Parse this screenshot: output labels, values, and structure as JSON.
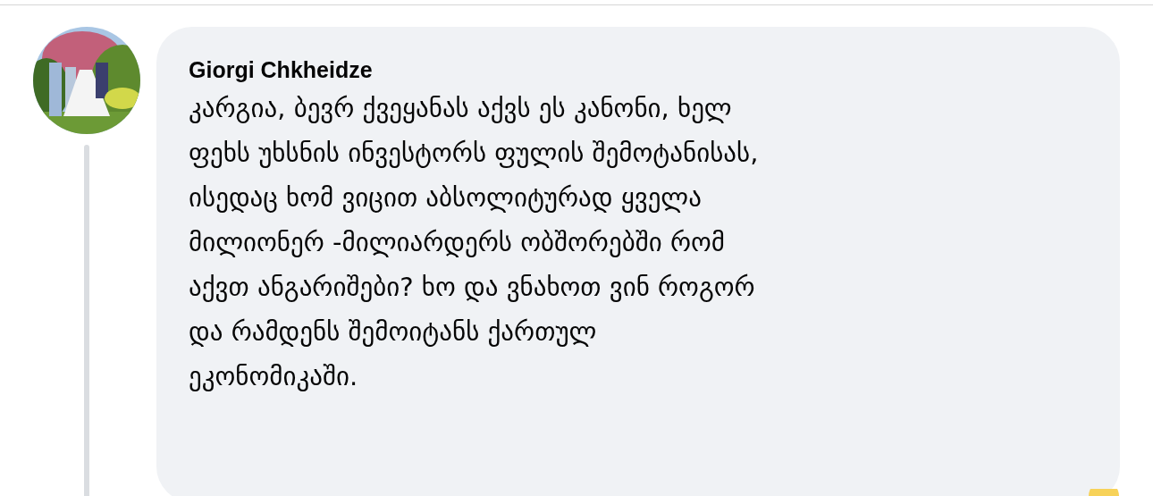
{
  "comment": {
    "author": "Giorgi Chkheidze",
    "text": "კარგია, ბევრ ქვეყანას აქვს ეს კანონი, ხელ\nფეხს უხსნის ინვესტორს ფულის შემოტანისას,\nისედაც ხომ ვიცით აბსოლიტურად ყველა\nმილიონერ -მილიარდერს ობშორებში რომ\nაქვთ ანგარიშები? ხო და ვნახოთ ვინ როგორ\nდა რამდენს შემოიტანს ქართულ\nეკონომიკაში."
  }
}
